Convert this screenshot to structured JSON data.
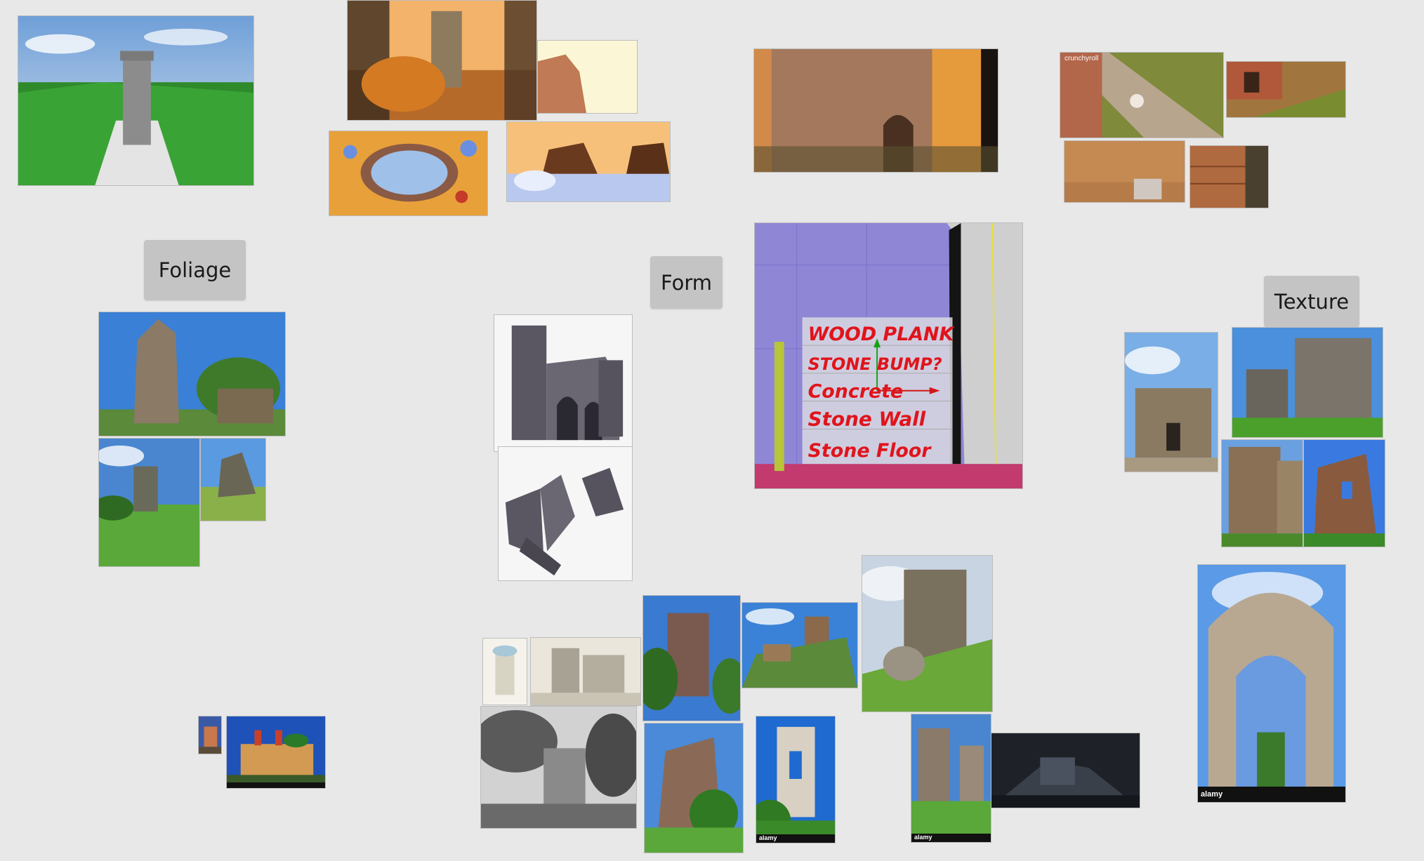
{
  "board": {
    "labels": {
      "foliage": "Foliage",
      "form": "Form",
      "texture": "Texture"
    },
    "annotations": {
      "line1": "WOOD PLANK",
      "line2": "STONE BUMP?",
      "line3": "Concrete",
      "line4": "Stone Wall",
      "line5": "Stone Floor"
    },
    "watermarks": {
      "crunchyroll": "crunchyroll",
      "alamy": "alamy"
    }
  }
}
